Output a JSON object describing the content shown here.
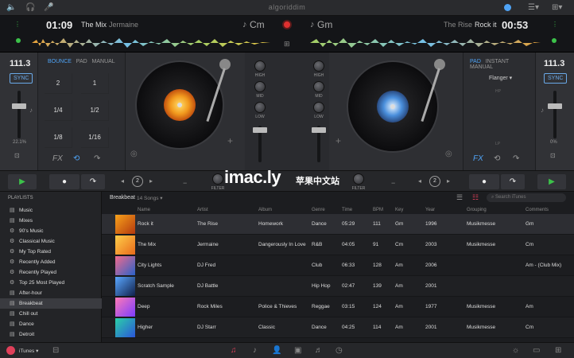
{
  "app": {
    "brand": "algoriddim"
  },
  "deck_left": {
    "time": "01:09",
    "title": "The Mix",
    "artist": "Jermaine",
    "key": "Cm",
    "bpm": "111.3",
    "sync": "SYNC",
    "pitch": "22.1%",
    "tabs": [
      "BOUNCE",
      "PAD",
      "MANUAL"
    ],
    "pads": [
      "2",
      "1",
      "1/4",
      "1/2",
      "1/8",
      "1/16"
    ],
    "fx": "FX",
    "loop": "2"
  },
  "deck_right": {
    "time": "00:53",
    "title": "Rock it",
    "artist": "The Rise",
    "key": "Gm",
    "bpm": "111.3",
    "sync": "SYNC",
    "pitch": "0%",
    "tabs": [
      "PAD",
      "INSTANT",
      "MANUAL"
    ],
    "effect": "Flanger",
    "hp": "HP",
    "lp": "LP",
    "fx": "FX",
    "loop": "2"
  },
  "mixer": {
    "labels": [
      "HIGH",
      "MID",
      "LOW"
    ],
    "filter": "FILTER"
  },
  "watermark": {
    "text": "imac.ly",
    "cn": "苹果中文站"
  },
  "sidebar": {
    "heading": "PLAYLISTS",
    "items": [
      {
        "label": "Music",
        "icon": "playlist-icon"
      },
      {
        "label": "Mixes",
        "icon": "playlist-icon"
      },
      {
        "label": "90's Music",
        "icon": "smart-playlist-icon"
      },
      {
        "label": "Classical Music",
        "icon": "smart-playlist-icon"
      },
      {
        "label": "My Top Rated",
        "icon": "smart-playlist-icon"
      },
      {
        "label": "Recently Added",
        "icon": "smart-playlist-icon"
      },
      {
        "label": "Recently Played",
        "icon": "smart-playlist-icon"
      },
      {
        "label": "Top 25 Most Played",
        "icon": "smart-playlist-icon"
      },
      {
        "label": "After-hour",
        "icon": "playlist-icon"
      },
      {
        "label": "Breakbeat",
        "icon": "playlist-icon"
      },
      {
        "label": "Chill out",
        "icon": "playlist-icon"
      },
      {
        "label": "Dance",
        "icon": "playlist-icon"
      },
      {
        "label": "Detroit",
        "icon": "playlist-icon"
      }
    ]
  },
  "library": {
    "title": "Breakbeat",
    "count": "14 Songs",
    "search_placeholder": "Search iTunes",
    "columns": [
      "Name",
      "Artist",
      "Album",
      "Genre",
      "Time",
      "BPM",
      "Key",
      "Year",
      "Grouping",
      "Comments"
    ],
    "rows": [
      [
        "Rock it",
        "The Rise",
        "Homework",
        "Dance",
        "05:29",
        "111",
        "Gm",
        "1996",
        "Musikmesse",
        "Gm"
      ],
      [
        "The Mix",
        "Jermaine",
        "Dangerously In Love",
        "R&B",
        "04:05",
        "91",
        "Cm",
        "2003",
        "Musikmesse",
        "Cm"
      ],
      [
        "City Lights",
        "DJ Fred",
        "",
        "Club",
        "06:33",
        "128",
        "Am",
        "2006",
        "",
        "Am - (Club Mix)"
      ],
      [
        "Scratch Sample",
        "DJ Battle",
        "",
        "Hip Hop",
        "02:47",
        "139",
        "Am",
        "2001",
        "",
        ""
      ],
      [
        "Deep",
        "Rock Miles",
        "Police & Thieves",
        "Reggae",
        "03:15",
        "124",
        "Am",
        "1977",
        "Musikmesse",
        "Am"
      ],
      [
        "Higher",
        "DJ Starr",
        "Classic",
        "Dance",
        "04:25",
        "114",
        "Am",
        "2001",
        "Musikmesse",
        "Cm"
      ]
    ]
  },
  "bottombar": {
    "source": "iTunes"
  },
  "colors": {
    "accent": "#4fa3f5",
    "record": "#e03030",
    "play": "#3cc24a",
    "waveform": "#7fd3ff"
  }
}
